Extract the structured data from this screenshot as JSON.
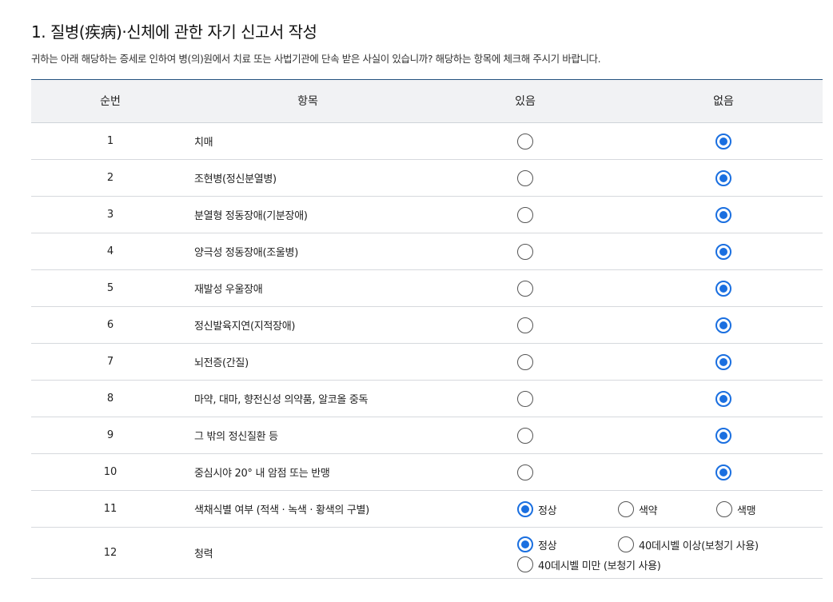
{
  "section": {
    "title": "1. 질병(疾病)·신체에 관한 자기 신고서 작성",
    "description": "귀하는 아래 해당하는 증세로 인하여 병(의)원에서 치료 또는 사법기관에 단속 받은 사실이 있습니까? 해당하는 항목에 체크해 주시기 바랍니다."
  },
  "table": {
    "headers": {
      "no": "순번",
      "item": "항목",
      "yes": "있음",
      "no_col": "없음"
    },
    "rows": [
      {
        "no": "1",
        "item": "치매",
        "selected": "없음"
      },
      {
        "no": "2",
        "item": "조현병(정신분열병)",
        "selected": "없음"
      },
      {
        "no": "3",
        "item": "분열형 정동장애(기분장애)",
        "selected": "없음"
      },
      {
        "no": "4",
        "item": "양극성 정동장애(조울병)",
        "selected": "없음"
      },
      {
        "no": "5",
        "item": "재발성 우울장애",
        "selected": "없음"
      },
      {
        "no": "6",
        "item": "정신발육지연(지적장애)",
        "selected": "없음"
      },
      {
        "no": "7",
        "item": "뇌전증(간질)",
        "selected": "없음"
      },
      {
        "no": "8",
        "item": "마약, 대마, 향전신성 의약품, 알코올 중독",
        "selected": "없음"
      },
      {
        "no": "9",
        "item": "그 밖의 정신질환 등",
        "selected": "없음"
      },
      {
        "no": "10",
        "item": "중심시야 20° 내 암점 또는 반맹",
        "selected": "없음"
      }
    ],
    "color_vision": {
      "no": "11",
      "item": "색채식별 여부 (적색 · 녹색 · 황색의 구별)",
      "options": [
        "정상",
        "색약",
        "색맹"
      ],
      "selected": "정상"
    },
    "hearing": {
      "no": "12",
      "item": "청력",
      "options": [
        "정상",
        "40데시벨 이상(보청기 사용)",
        "40데시벨 미만 (보청기 사용)"
      ],
      "selected": "정상"
    }
  },
  "colors": {
    "accent": "#1a6fe0",
    "header_bg": "#f1f2f4",
    "top_border": "#24527f"
  }
}
